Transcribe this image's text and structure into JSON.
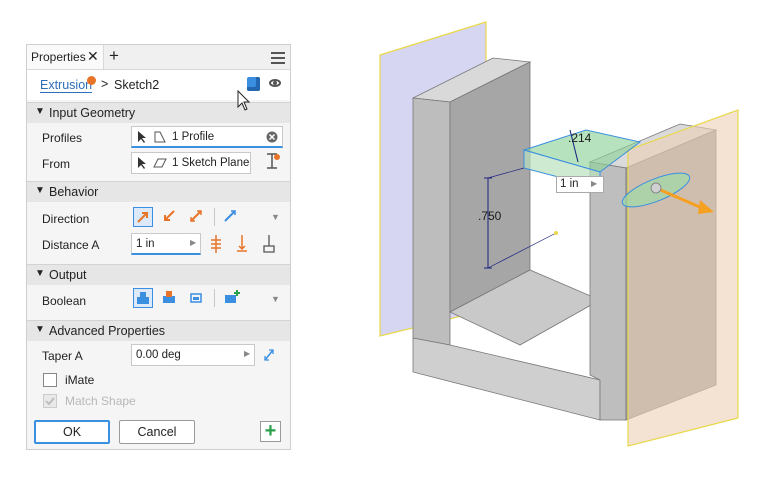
{
  "panel": {
    "tab_label": "Properties",
    "tab_close": "✕",
    "tab_add": "+",
    "breadcrumb": {
      "parent": "Extrusion",
      "separator": ">",
      "current": "Sketch2"
    },
    "sections": {
      "input_geometry": "Input Geometry",
      "behavior": "Behavior",
      "output": "Output",
      "advanced": "Advanced Properties"
    },
    "input_geometry": {
      "profiles_label": "Profiles",
      "profiles_value": "1 Profile",
      "from_label": "From",
      "from_value": "1 Sketch Plane"
    },
    "behavior": {
      "direction_label": "Direction",
      "distance_label": "Distance A",
      "distance_value": "1 in"
    },
    "output": {
      "boolean_label": "Boolean"
    },
    "advanced": {
      "taper_label": "Taper A",
      "taper_value": "0.00 deg",
      "imate_label": "iMate",
      "match_shape_label": "Match Shape"
    },
    "footer": {
      "ok_label": "OK",
      "cancel_label": "Cancel"
    }
  },
  "viewport": {
    "dim_vertical": ".750",
    "dim_width": ".214",
    "distance_popup": "1 in",
    "accent_color": "#3a8fe0",
    "arrow_color": "#f5a020"
  },
  "icons": [
    "close-icon",
    "add-tab-icon",
    "menu-icon",
    "cube-icon",
    "eye-icon",
    "cursor-icon",
    "profile-icon",
    "sketch-plane-icon",
    "clear-icon",
    "direction-icons",
    "boolean-icons",
    "plus-icon"
  ]
}
